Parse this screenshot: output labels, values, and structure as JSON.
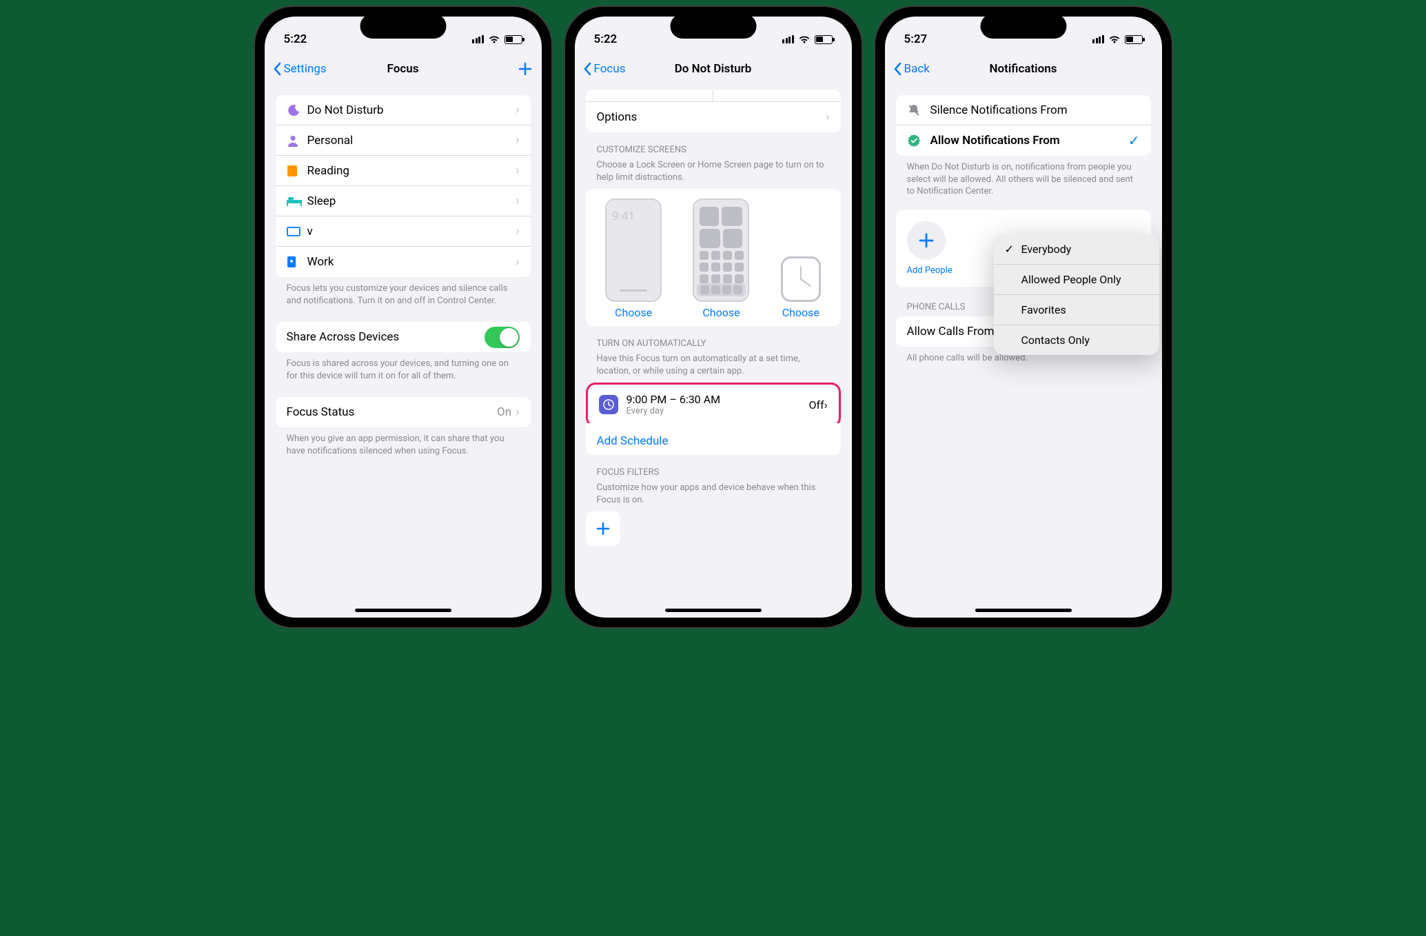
{
  "phone1": {
    "time": "5:22",
    "nav": {
      "back": "Settings",
      "title": "Focus"
    },
    "focusList": [
      {
        "label": "Do Not Disturb",
        "iconClass": "ic-moon",
        "glyph": "☾"
      },
      {
        "label": "Personal",
        "iconClass": "ic-person",
        "glyph": "👤"
      },
      {
        "label": "Reading",
        "iconClass": "ic-book",
        "glyph": "▮"
      },
      {
        "label": "Sleep",
        "iconClass": "ic-bed",
        "glyph": "🛏"
      },
      {
        "label": "v",
        "iconClass": "ic-display",
        "glyph": "▭"
      },
      {
        "label": "Work",
        "iconClass": "ic-badge",
        "glyph": "▯"
      }
    ],
    "focusFooter": "Focus lets you customize your devices and silence calls and notifications. Turn it on and off in Control Center.",
    "share": {
      "label": "Share Across Devices"
    },
    "shareFooter": "Focus is shared across your devices, and turning one on for this device will turn it on for all of them.",
    "status": {
      "label": "Focus Status",
      "value": "On"
    },
    "statusFooter": "When you give an app permission, it can share that you have notifications silenced when using Focus."
  },
  "phone2": {
    "time": "5:22",
    "nav": {
      "back": "Focus",
      "title": "Do Not Disturb"
    },
    "optionsLabel": "Options",
    "customize": {
      "header": "CUSTOMIZE SCREENS",
      "sub": "Choose a Lock Screen or Home Screen page to turn on to help limit distractions.",
      "lockTime": "9:41",
      "choose": "Choose"
    },
    "auto": {
      "header": "TURN ON AUTOMATICALLY",
      "sub": "Have this Focus turn on automatically at a set time, location, or while using a certain app.",
      "scheduleTime": "9:00 PM – 6:30 AM",
      "scheduleRepeat": "Every day",
      "scheduleState": "Off",
      "addSchedule": "Add Schedule"
    },
    "filters": {
      "header": "FOCUS FILTERS",
      "sub": "Customize how your apps and device behave when this Focus is on."
    }
  },
  "phone3": {
    "time": "5:27",
    "nav": {
      "back": "Back",
      "title": "Notifications"
    },
    "silenceLabel": "Silence Notifications From",
    "allowLabel": "Allow Notifications From",
    "explain": "When Do Not Disturb is on, notifications from people you select will be allowed. All others will be silenced and sent to Notification Center.",
    "addPeople": "Add People",
    "callsHeader": "PHONE CALLS",
    "callsRow": {
      "label": "Allow Calls From",
      "value": "Everybody"
    },
    "callsFooter": "All phone calls will be allowed.",
    "popup": {
      "options": [
        "Everybody",
        "Allowed People Only",
        "Favorites",
        "Contacts Only"
      ],
      "selected": "Everybody"
    }
  }
}
